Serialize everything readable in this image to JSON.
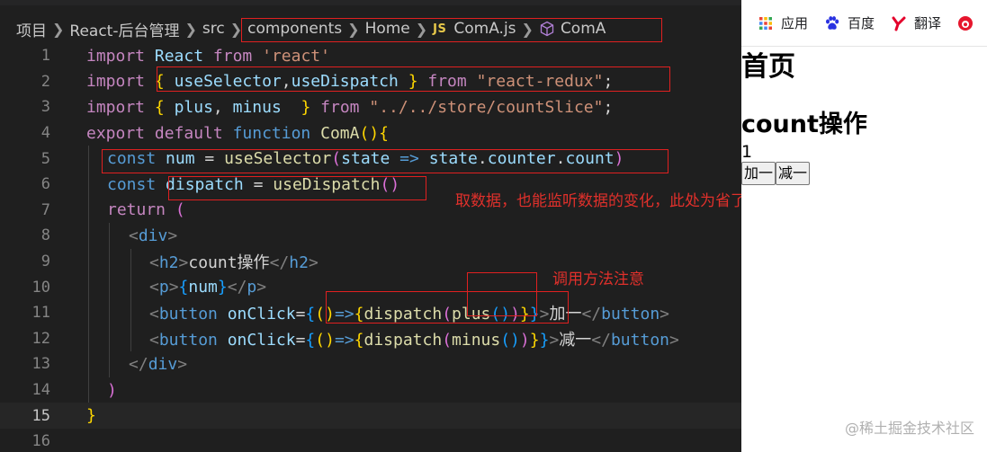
{
  "breadcrumb": {
    "items": [
      "项目",
      "React-后台管理",
      "src",
      "components",
      "Home"
    ],
    "js_badge": "JS",
    "file": "ComA.js",
    "symbol": "ComA"
  },
  "line_numbers": [
    "1",
    "2",
    "3",
    "4",
    "5",
    "6",
    "7",
    "8",
    "9",
    "10",
    "11",
    "12",
    "13",
    "14",
    "15",
    "16"
  ],
  "code": {
    "l1": {
      "t1": "import",
      "t2": "React",
      "t3": "from",
      "t4": "'react'"
    },
    "l2": {
      "t1": "import",
      "t2": "{",
      "t3": "useSelector",
      "t4": ",",
      "t5": "useDispatch",
      "t6": "}",
      "t7": "from",
      "t8": "\"react-redux\"",
      "t9": ";"
    },
    "l3": {
      "t1": "import",
      "t2": "{",
      "t3": "plus",
      "t4": ", ",
      "t5": "minus",
      "t6": "}",
      "t7": "from",
      "t8": "\"../../store/countSlice\"",
      "t9": ";"
    },
    "l4": {
      "t1": "export",
      "t2": "default",
      "t3": "function",
      "t4": "ComA",
      "t5": "()",
      "t6": "{"
    },
    "l5": {
      "t1": "const",
      "t2": "num",
      "t3": "=",
      "t4": "useSelector",
      "t5": "(",
      "t6": "state",
      "t7": "=>",
      "t8": "state",
      "t9": ".",
      "t10": "counter",
      "t11": ".",
      "t12": "count",
      "t13": ")"
    },
    "l6": {
      "t1": "const",
      "t2": "dispatch",
      "t3": "=",
      "t4": "useDispatch",
      "t5": "()"
    },
    "l7": {
      "t1": "return",
      "t2": "("
    },
    "l8": {
      "t1": "<",
      "t2": "div",
      "t3": ">"
    },
    "l9": {
      "t1": "<",
      "t2": "h2",
      "t3": ">",
      "t4": "count操作",
      "t5": "</",
      "t6": "h2",
      "t7": ">"
    },
    "l10": {
      "t1": "<",
      "t2": "p",
      "t3": ">",
      "t4": "{",
      "t5": "num",
      "t6": "}",
      "t7": "</",
      "t8": "p",
      "t9": ">"
    },
    "l11": {
      "t1": "<",
      "t2": "button",
      "t3": "onClick",
      "t4": "=",
      "t5": "{",
      "t6": "()",
      "t7": "=>",
      "t8": "{",
      "t9": "dispatch",
      "t10": "(",
      "t11": "plus",
      "t12": "()",
      "t13": ")",
      "t14": "}",
      "t15": "}",
      "t16": ">",
      "t17": "加一",
      "t18": "</",
      "t19": "button",
      "t20": ">"
    },
    "l12": {
      "t1": "<",
      "t2": "button",
      "t3": "onClick",
      "t4": "=",
      "t5": "{",
      "t6": "()",
      "t7": "=>",
      "t8": "{",
      "t9": "dispatch",
      "t10": "(",
      "t11": "minus",
      "t12": "()",
      "t13": ")",
      "t14": "}",
      "t15": "}",
      "t16": ">",
      "t17": "减一",
      "t18": "</",
      "t19": "button",
      "t20": ">"
    },
    "l13": {
      "t1": "</",
      "t2": "div",
      "t3": ">"
    },
    "l14": {
      "t1": ")"
    },
    "l15": {
      "t1": "}"
    }
  },
  "annotations": {
    "selector_note": "取数据，也能监听数据的变化，此处为省了return的写法",
    "dispatch_note": "调用方法注意"
  },
  "browser": {
    "bookmarks": [
      {
        "label": "应用",
        "icon": "apps-grid-icon"
      },
      {
        "label": "百度",
        "icon": "baidu-paw-icon"
      },
      {
        "label": "翻译",
        "icon": "youdao-y-icon"
      }
    ],
    "page_h1": "首页",
    "page_h2": "count操作",
    "count_value": "1",
    "plus_button": "加一",
    "minus_button": "减一",
    "watermark": "@稀土掘金技术社区"
  },
  "colors": {
    "keyword": "#569cd6",
    "control_keyword": "#c586c0",
    "variable": "#9cdcfe",
    "string": "#ce9178",
    "function": "#dcdcaa",
    "annotation_red": "#e0302b"
  }
}
